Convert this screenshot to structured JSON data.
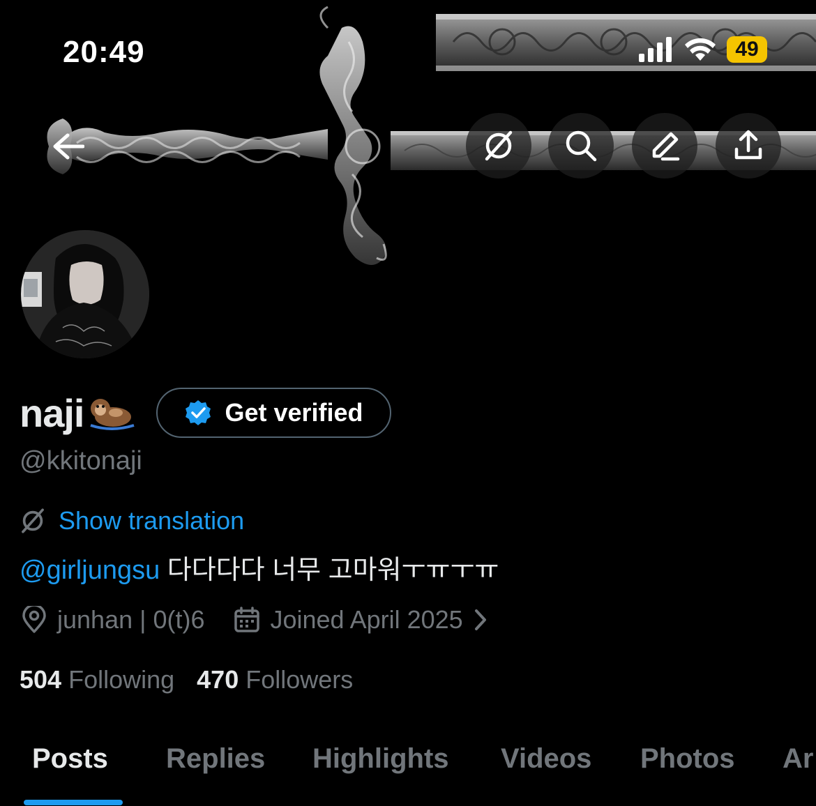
{
  "status_bar": {
    "time": "20:49",
    "battery": "49",
    "icons": [
      "signal-icon",
      "wifi-icon",
      "battery-icon"
    ]
  },
  "nav": {
    "icons": [
      "back-arrow-icon",
      "translate-icon",
      "search-icon",
      "edit-icon",
      "share-icon"
    ]
  },
  "profile": {
    "display_name": "naji",
    "name_emoji": "otter",
    "get_verified_label": "Get verified",
    "handle": "@kkitonaji",
    "show_translation_label": "Show translation",
    "bio_mention": "@girljungsu",
    "bio_text": "다다다다 너무 고마워ㅜㅠㅜㅠ",
    "location": "junhan | 0(t)6",
    "joined": "Joined April 2025",
    "following_count": "504",
    "following_label": "Following",
    "followers_count": "470",
    "followers_label": "Followers"
  },
  "tabs": [
    {
      "label": "Posts",
      "active": true
    },
    {
      "label": "Replies",
      "active": false
    },
    {
      "label": "Highlights",
      "active": false
    },
    {
      "label": "Videos",
      "active": false
    },
    {
      "label": "Photos",
      "active": false
    },
    {
      "label": "Ar",
      "active": false
    }
  ],
  "colors": {
    "background": "#000000",
    "accent": "#1d9bf0",
    "muted_text": "#71767b",
    "primary_text": "#e7e9ea",
    "battery": "#f5c400"
  }
}
